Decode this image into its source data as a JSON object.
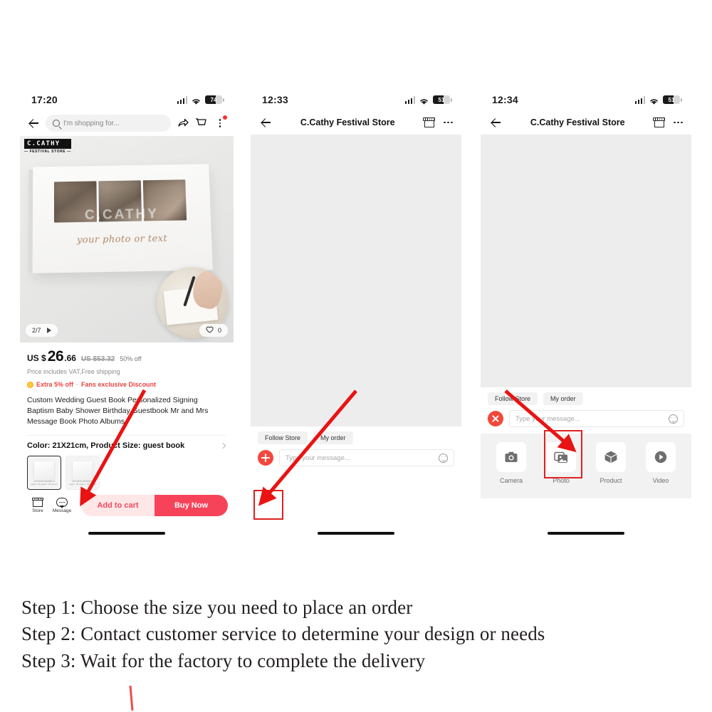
{
  "phone1": {
    "status": {
      "time": "17:20",
      "battery": "74",
      "signal_icon": "cellular-signal-icon",
      "wifi_icon": "wifi-icon"
    },
    "nav": {
      "back_icon": "back-arrow-icon",
      "search_placeholder": "I'm shopping for...",
      "share_icon": "share-icon",
      "cart_icon": "cart-icon",
      "more_icon": "more-vertical-icon"
    },
    "gallery": {
      "brand_main": "C.CATHY",
      "brand_sub": "— FESTIVAL STORE —",
      "book_script": "your photo or text",
      "watermark": "C.CATHY",
      "page_counter": "2/7",
      "play_icon": "play-icon",
      "like_icon": "heart-icon",
      "like_count": "0"
    },
    "price": {
      "currency": "US $",
      "amount_main": "26",
      "amount_dec": ".66",
      "old_price": "US $53.32",
      "discount": "50% off",
      "vat_note": "Price includes VAT,Free shipping",
      "promo_badge": "Extra 5% off",
      "promo_sep": "·",
      "promo_text": "Fans exclusive Discount"
    },
    "title": "Custom Wedding Guest Book Personalized Signing Baptism Baby Shower Birthday Guestbook Mr and Mrs Message Book Photo Albums",
    "variant": {
      "label": "Color: 21X21cm, Product Size: guest book",
      "chevron_icon": "chevron-right-icon",
      "swatches": [
        {
          "caption": "21 X 21 cm Number of pages: 60 pages / 30 sheets",
          "selected": true
        },
        {
          "caption": "20 X 25 cm Number of pages: 60 pages / 30 sheets",
          "selected": false
        }
      ]
    },
    "actions": {
      "store_label": "Store",
      "store_icon": "store-icon",
      "message_label": "Message",
      "message_icon": "chat-bubble-icon",
      "add_to_cart": "Add to cart",
      "buy_now": "Buy Now"
    }
  },
  "phone2": {
    "status": {
      "time": "12:33",
      "battery": "51"
    },
    "nav": {
      "back_icon": "back-arrow-icon",
      "title": "C.Cathy Festival Store",
      "store_icon": "store-icon",
      "more_icon": "more-horizontal-icon"
    },
    "quick_chips": [
      "Follow Store",
      "My order"
    ],
    "input": {
      "plus_icon": "plus-circle-icon",
      "placeholder": "Type your message...",
      "emoji_icon": "smiley-icon"
    }
  },
  "phone3": {
    "status": {
      "time": "12:34",
      "battery": "51"
    },
    "nav": {
      "back_icon": "back-arrow-icon",
      "title": "C.Cathy Festival Store",
      "store_icon": "store-icon",
      "more_icon": "more-horizontal-icon"
    },
    "quick_chips": [
      "Follow Store",
      "My order"
    ],
    "input": {
      "close_icon": "close-circle-icon",
      "placeholder": "Type your message...",
      "emoji_icon": "smiley-icon"
    },
    "attachments": [
      {
        "label": "Camera",
        "icon": "camera-icon"
      },
      {
        "label": "Photo",
        "icon": "photo-icon"
      },
      {
        "label": "Product",
        "icon": "box-icon"
      },
      {
        "label": "Video",
        "icon": "video-play-icon"
      }
    ]
  },
  "steps": [
    "Step 1: Choose the size  you need to place an order",
    "Step 2: Contact customer service to determine your design or needs",
    "Step 3: Wait for the factory to complete the delivery"
  ],
  "colors": {
    "accent_red": "#f7435a",
    "annotation_red": "#e02020",
    "promo_red": "#e8443f",
    "chat_bg": "#ededed"
  }
}
